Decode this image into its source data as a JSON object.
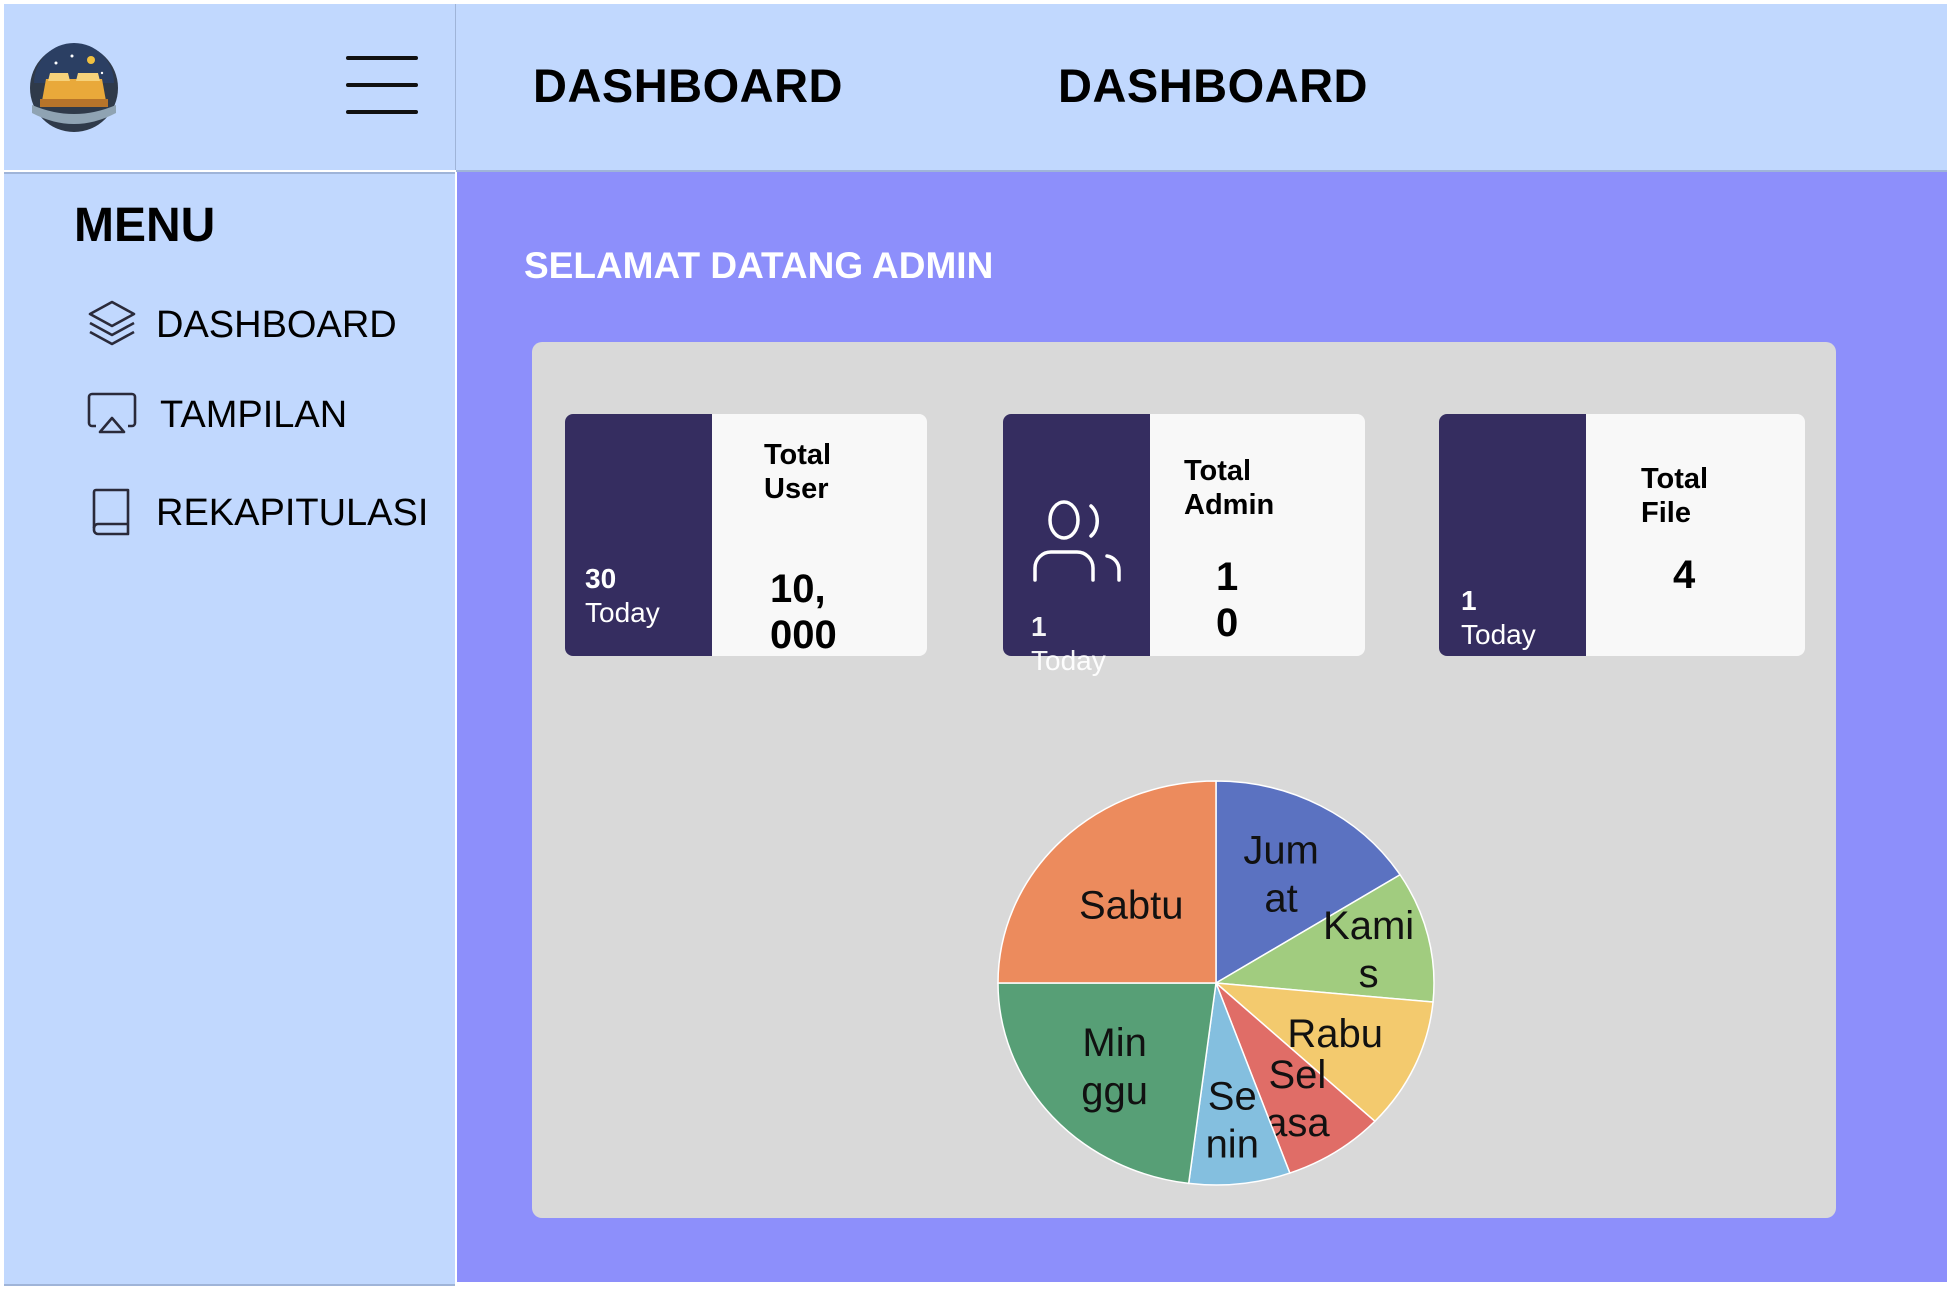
{
  "header": {
    "titles": [
      "DASHBOARD",
      "DASHBOARD"
    ],
    "logo_icon": "hotel-bed-logo",
    "menu_icon": "hamburger-icon"
  },
  "sidebar": {
    "heading": "MENU",
    "items": [
      {
        "label": "DASHBOARD",
        "icon": "layers-icon"
      },
      {
        "label": "TAMPILAN",
        "icon": "airplay-icon"
      },
      {
        "label": "REKAPITULASI",
        "icon": "book-icon"
      }
    ]
  },
  "main": {
    "welcome": "SELAMAT DATANG ADMIN",
    "cards": [
      {
        "title_line1": "Total",
        "title_line2": "User",
        "value_line1": "10,",
        "value_line2": "000",
        "sub_count": "30",
        "sub_label": "Today"
      },
      {
        "title_line1": "Total",
        "title_line2": "Admin",
        "value_line1": "1",
        "value_line2": "0",
        "sub_count": "1",
        "sub_label": "Today",
        "icon": "users-icon"
      },
      {
        "title_line1": "Total",
        "title_line2": "File",
        "value_line1": "4",
        "value_line2": "",
        "sub_count": "1",
        "sub_label": "Today"
      }
    ]
  },
  "chart_data": {
    "type": "pie",
    "title": "",
    "categories": [
      "Jumat",
      "Kamis",
      "Rabu",
      "Selasa",
      "Senin",
      "Minggu",
      "Sabtu"
    ],
    "values": [
      16.0,
      10.5,
      10.5,
      7.5,
      7.5,
      23.0,
      25.0
    ],
    "colors": [
      "#5b72c1",
      "#a1cc7f",
      "#f3ca6e",
      "#e06d67",
      "#84bfdf",
      "#579f76",
      "#ec8b5d"
    ],
    "label_lines": [
      [
        "Jum",
        "at"
      ],
      [
        "Kami",
        "s"
      ],
      [
        "Rabu"
      ],
      [
        "Sel",
        "asa"
      ],
      [
        "Se",
        "nin"
      ],
      [
        "Min",
        "ggu"
      ],
      [
        "Sabtu"
      ]
    ]
  },
  "colors": {
    "header_bg": "#c1d8fe",
    "main_bg": "#8d8ffb",
    "panel_bg": "#d9d9d9",
    "card_dark": "#352d60",
    "card_bg": "#f8f8f8"
  }
}
